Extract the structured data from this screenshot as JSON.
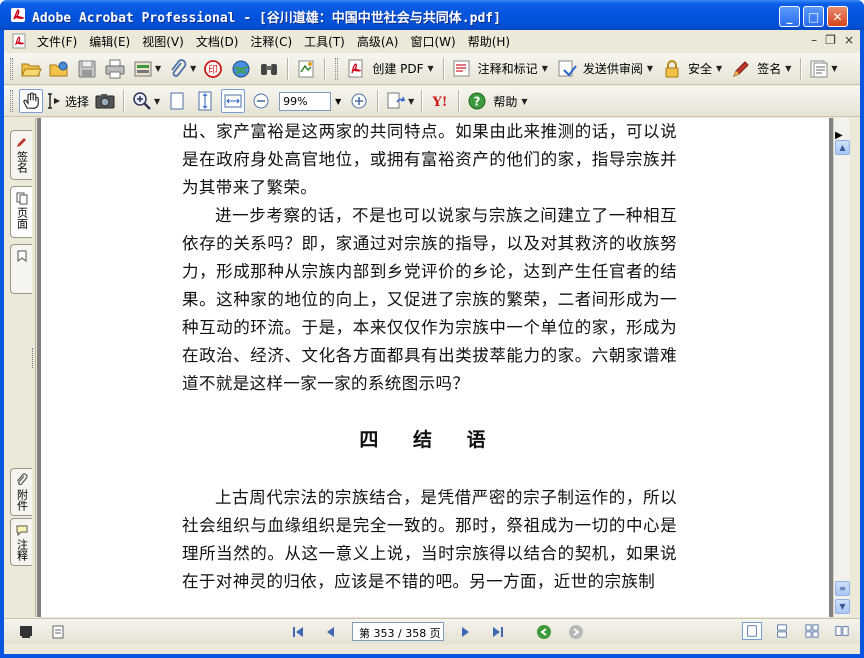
{
  "window": {
    "title": "Adobe Acrobat Professional - [谷川道雄：中国中世社会与共同体.pdf]",
    "minimize": "_",
    "maximize": "□",
    "close": "✕"
  },
  "menu": {
    "items": [
      "文件(F)",
      "编辑(E)",
      "视图(V)",
      "文档(D)",
      "注释(C)",
      "工具(T)",
      "高级(A)",
      "窗口(W)",
      "帮助(H)"
    ],
    "mdi_minimize": "–",
    "mdi_restore": "❐",
    "mdi_close": "×"
  },
  "toolbar1": {
    "create_pdf": "创建 PDF",
    "comment_markup": "注释和标记",
    "send_review": "发送供审阅",
    "security": "安全",
    "sign": "签名"
  },
  "toolbar2": {
    "select": "选择",
    "zoom_value": "99%",
    "help": "帮助"
  },
  "side_tabs": {
    "signatures": "签名",
    "pages": "页面",
    "attachments": "附件",
    "comments": "注释"
  },
  "document": {
    "paragraphs": [
      {
        "indent": false,
        "text": "出、家产富裕是这两家的共同特点。如果由此来推测的话，可以说是在政府身处高官地位，或拥有富裕资产的他们的家，指导宗族并为其带来了繁荣。"
      },
      {
        "indent": true,
        "text": "进一步考察的话，不是也可以说家与宗族之间建立了一种相互依存的关系吗？即，家通过对宗族的指导，以及对其救济的收族努力，形成那种从宗族内部到乡党评价的乡论，达到产生任官者的结果。这种家的地位的向上，又促进了宗族的繁荣，二者间形成为一种互动的环流。于是，本来仅仅作为宗族中一个单位的家，形成为在政治、经济、文化各方面都具有出类拔萃能力的家。六朝家谱难道不就是这样一家一家的系统图示吗？"
      }
    ],
    "heading": "四 结 语",
    "paragraphs2": [
      {
        "indent": true,
        "text": "上古周代宗法的宗族结合，是凭借严密的宗子制运作的，所以社会组织与血缘组织是完全一致的。那时，祭祖成为一切的中心是理所当然的。从这一意义上说，当时宗族得以结合的契机，如果说在于对神灵的归依，应该是不错的吧。另一方面，近世的宗族制"
      }
    ]
  },
  "status": {
    "page_display": "第 353 / 358 页"
  },
  "colors": {
    "titlebar": "#0553dd",
    "chrome": "#ece9d8",
    "doc_background": "#808080"
  }
}
